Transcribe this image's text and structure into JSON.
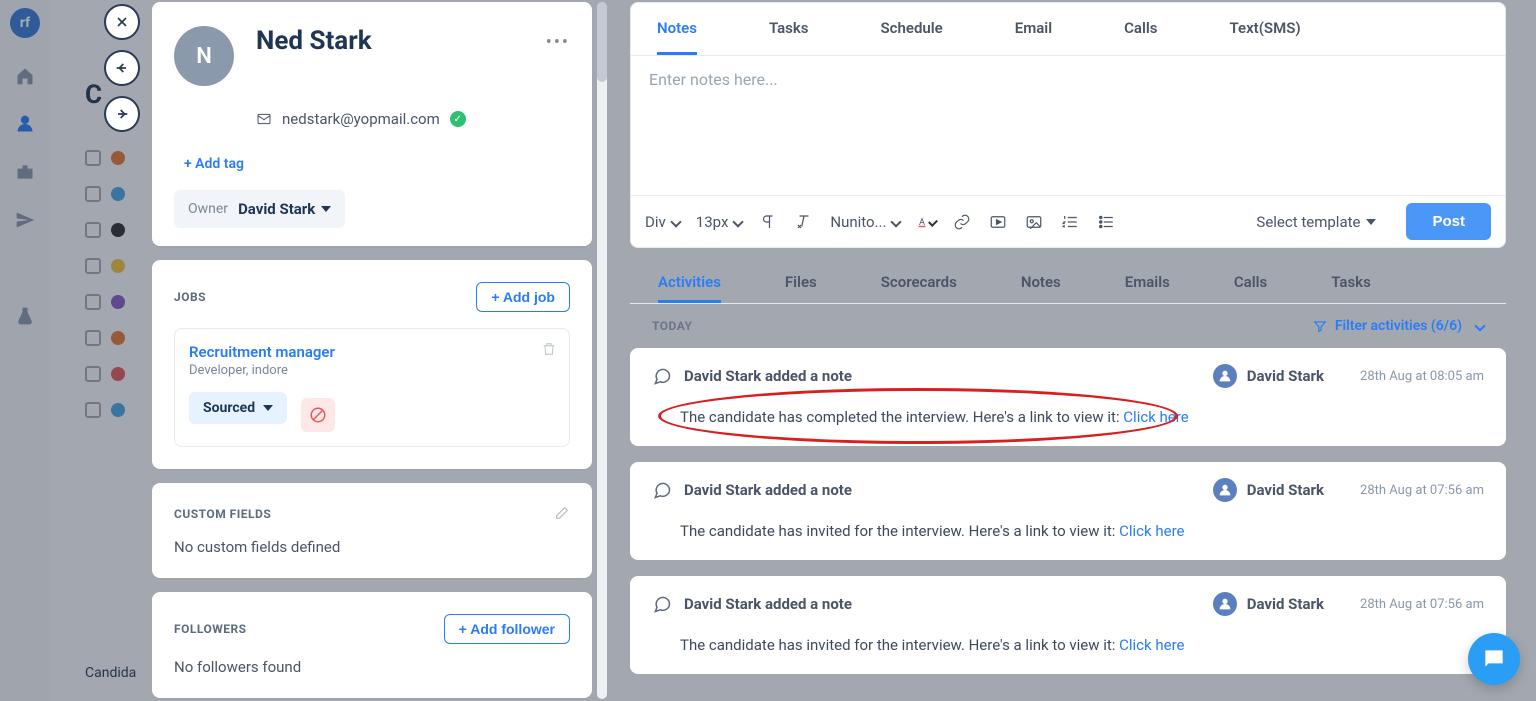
{
  "bg": {
    "title": "C",
    "footer": "Candida"
  },
  "profile": {
    "initial": "N",
    "name": "Ned Stark",
    "email": "nedstark@yopmail.com",
    "add_tag": "+ Add tag",
    "owner_label": "Owner",
    "owner_value": "David Stark"
  },
  "jobs": {
    "header": "JOBS",
    "add_btn": "+ Add job",
    "item": {
      "title": "Recruitment manager",
      "subtitle": "Developer, indore",
      "status": "Sourced"
    }
  },
  "custom_fields": {
    "header": "CUSTOM FIELDS",
    "empty": "No custom fields defined"
  },
  "followers": {
    "header": "FOLLOWERS",
    "add_btn": "+ Add follower",
    "empty": "No followers found"
  },
  "compose": {
    "tabs": [
      "Notes",
      "Tasks",
      "Schedule",
      "Email",
      "Calls",
      "Text(SMS)"
    ],
    "active_tab_index": 0,
    "placeholder": "Enter notes here...",
    "format_block": "Div",
    "font_size": "13px",
    "font_family": "Nunito...",
    "template": "Select template",
    "post": "Post"
  },
  "feed": {
    "tabs": [
      "Activities",
      "Files",
      "Scorecards",
      "Notes",
      "Emails",
      "Calls",
      "Tasks"
    ],
    "active_tab_index": 0,
    "day_label": "TODAY",
    "filter_label": "Filter activities (6/6)",
    "activities": [
      {
        "title": "David Stark added a note",
        "user": "David Stark",
        "time": "28th Aug at 08:05 am",
        "body_pre": "The candidate has completed the interview. Here's a link to view it: ",
        "link": "Click here"
      },
      {
        "title": "David Stark added a note",
        "user": "David Stark",
        "time": "28th Aug at 07:56 am",
        "body_pre": "The candidate has invited for the interview. Here's a link to view it: ",
        "link": "Click here"
      },
      {
        "title": "David Stark added a note",
        "user": "David Stark",
        "time": "28th Aug at 07:56 am",
        "body_pre": "The candidate has invited for the interview. Here's a link to view it: ",
        "link": "Click here"
      }
    ]
  },
  "dot_colors": [
    "#e27a3a",
    "#4da3e0",
    "#333",
    "#f0c040",
    "#8a5cc2",
    "#e27a3a",
    "#e05a5a",
    "#4da3e0"
  ]
}
